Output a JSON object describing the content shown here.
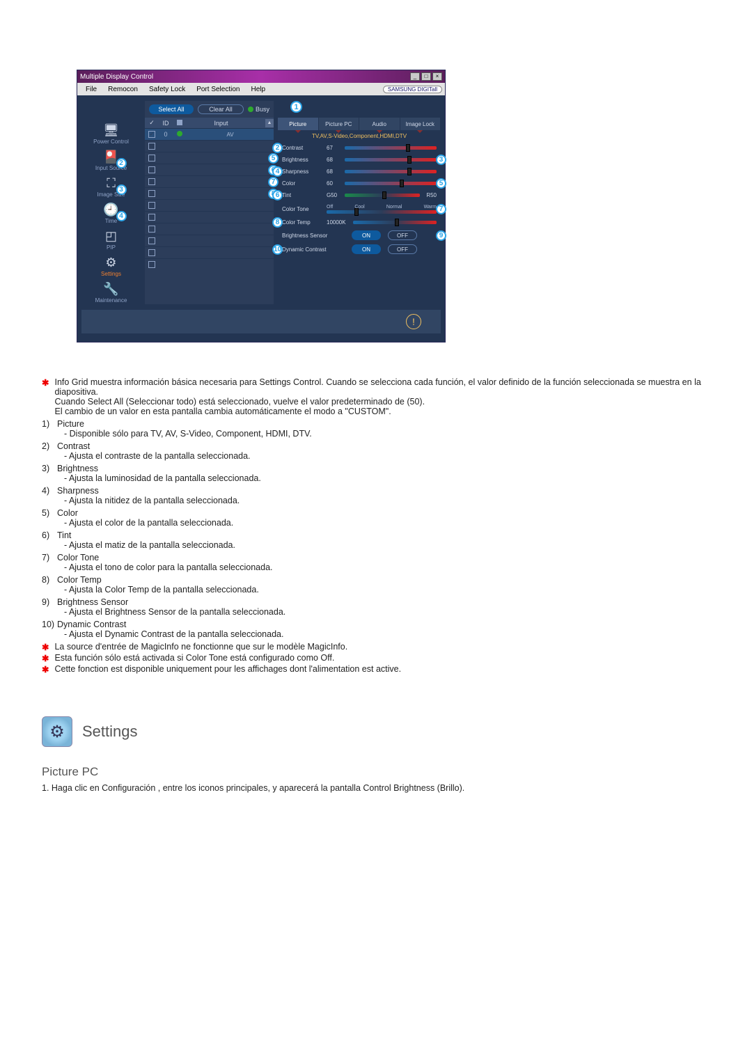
{
  "window": {
    "title": "Multiple Display Control",
    "menu": {
      "file": "File",
      "remocon": "Remocon",
      "safety": "Safety Lock",
      "port": "Port Selection",
      "help": "Help"
    },
    "brand": "SAMSUNG DIGITall"
  },
  "sidebar": {
    "items": [
      {
        "label": "Power Control"
      },
      {
        "label": "Input Source",
        "badge": "2"
      },
      {
        "label": "Image Size",
        "badge": "3"
      },
      {
        "label": "Time",
        "badge": "4"
      },
      {
        "label": "PIP"
      },
      {
        "label": "Settings",
        "active": true
      },
      {
        "label": "Maintenance"
      }
    ]
  },
  "grid": {
    "select_all": "Select All",
    "clear_all": "Clear All",
    "busy": "Busy",
    "head": {
      "check": "✓",
      "id": "ID",
      "sig": "",
      "input": "Input"
    },
    "rows": [
      {
        "checked": true,
        "id": "0",
        "sig": true,
        "input": "AV",
        "badge": ""
      },
      {
        "checked": false,
        "id": "",
        "sig": false,
        "input": "",
        "badge": ""
      },
      {
        "checked": false,
        "id": "",
        "sig": false,
        "input": "",
        "badge": "5"
      },
      {
        "checked": false,
        "id": "",
        "sig": false,
        "input": "",
        "badge": "6"
      },
      {
        "checked": false,
        "id": "",
        "sig": false,
        "input": "",
        "badge": "7"
      },
      {
        "checked": false,
        "id": "",
        "sig": false,
        "input": "",
        "badge": "8"
      },
      {
        "checked": false,
        "id": "",
        "sig": false,
        "input": "",
        "badge": ""
      },
      {
        "checked": false,
        "id": "",
        "sig": false,
        "input": "",
        "badge": ""
      },
      {
        "checked": false,
        "id": "",
        "sig": false,
        "input": "",
        "badge": ""
      },
      {
        "checked": false,
        "id": "",
        "sig": false,
        "input": "",
        "badge": ""
      },
      {
        "checked": false,
        "id": "",
        "sig": false,
        "input": "",
        "badge": ""
      },
      {
        "checked": false,
        "id": "",
        "sig": false,
        "input": "",
        "badge": ""
      }
    ]
  },
  "tabs": {
    "badge_over": "1",
    "items": [
      {
        "label": "Picture",
        "active": true
      },
      {
        "label": "Picture PC"
      },
      {
        "label": "Audio"
      },
      {
        "label": "Image Lock"
      }
    ]
  },
  "panel": {
    "subheader": "TV,AV,S-Video,Component,HDMI,DTV",
    "contrast": {
      "label": "Contrast",
      "value": "67",
      "lbadge": "2",
      "rbadge": ""
    },
    "brightness": {
      "label": "Brightness",
      "value": "68",
      "lbadge": "",
      "rbadge": "3"
    },
    "sharpness": {
      "label": "Sharpness",
      "value": "68",
      "lbadge": "4",
      "rbadge": ""
    },
    "color": {
      "label": "Color",
      "value": "60",
      "lbadge": "",
      "rbadge": "5"
    },
    "tint": {
      "label": "Tint",
      "value_l": "G50",
      "value_r": "R50",
      "lbadge": "6"
    },
    "tone": {
      "label": "Color Tone",
      "opts": {
        "off": "Off",
        "cool": "Cool",
        "normal": "Normal",
        "warm": "Warm"
      },
      "rbadge": "7"
    },
    "temp": {
      "label": "Color Temp",
      "value": "10000K",
      "lbadge": "8"
    },
    "bsensor": {
      "label": "Brightness Sensor",
      "on": "ON",
      "off": "OFF",
      "rbadge": "9"
    },
    "dcontrast": {
      "label": "Dynamic Contrast",
      "on": "ON",
      "off": "OFF",
      "lbadge": "10"
    }
  },
  "doc": {
    "notes": [
      "Info Grid muestra información básica necesaria para Settings Control. Cuando se selecciona cada función, el valor definido de la función seleccionada se muestra en la diapositiva.",
      "Cuando Select All (Seleccionar todo) está seleccionado, vuelve el valor predeterminado de (50).",
      "El cambio de un valor en esta pantalla cambia automáticamente el modo a \"CUSTOM\"."
    ],
    "items": [
      {
        "n": "1)",
        "title": "Picture",
        "desc": "- Disponible sólo para TV, AV, S-Video, Component, HDMI, DTV."
      },
      {
        "n": "2)",
        "title": "Contrast",
        "desc": "- Ajusta el contraste de la pantalla seleccionada."
      },
      {
        "n": "3)",
        "title": "Brightness",
        "desc": "- Ajusta la luminosidad de la pantalla seleccionada."
      },
      {
        "n": "4)",
        "title": "Sharpness",
        "desc": "- Ajusta la nitidez de la pantalla seleccionada."
      },
      {
        "n": "5)",
        "title": "Color",
        "desc": "- Ajusta el color de la pantalla seleccionada."
      },
      {
        "n": "6)",
        "title": "Tint",
        "desc": "- Ajusta el matiz de la pantalla seleccionada."
      },
      {
        "n": "7)",
        "title": "Color Tone",
        "desc": "- Ajusta el tono de color para la pantalla seleccionada."
      },
      {
        "n": "8)",
        "title": "Color Temp",
        "desc": "- Ajusta la Color Temp de la pantalla seleccionada."
      },
      {
        "n": "9)",
        "title": "Brightness Sensor",
        "desc": "- Ajusta el Brightness Sensor de la pantalla seleccionada."
      },
      {
        "n": "10)",
        "title": "Dynamic Contrast",
        "desc": "- Ajusta el Dynamic Contrast de la pantalla seleccionada."
      }
    ],
    "trailnotes": [
      "La source d'entrée de MagicInfo ne fonctionne que sur le modèle MagicInfo.",
      "Esta función sólo está activada si Color Tone está configurado como Off.",
      "Cette fonction est disponible uniquement pour les affichages dont l'alimentation est active."
    ]
  },
  "section": {
    "title": "Settings",
    "sub": "Picture PC",
    "step1": "1. Haga clic en Configuración , entre los iconos principales, y aparecerá la pantalla Control Brightness (Brillo)."
  }
}
